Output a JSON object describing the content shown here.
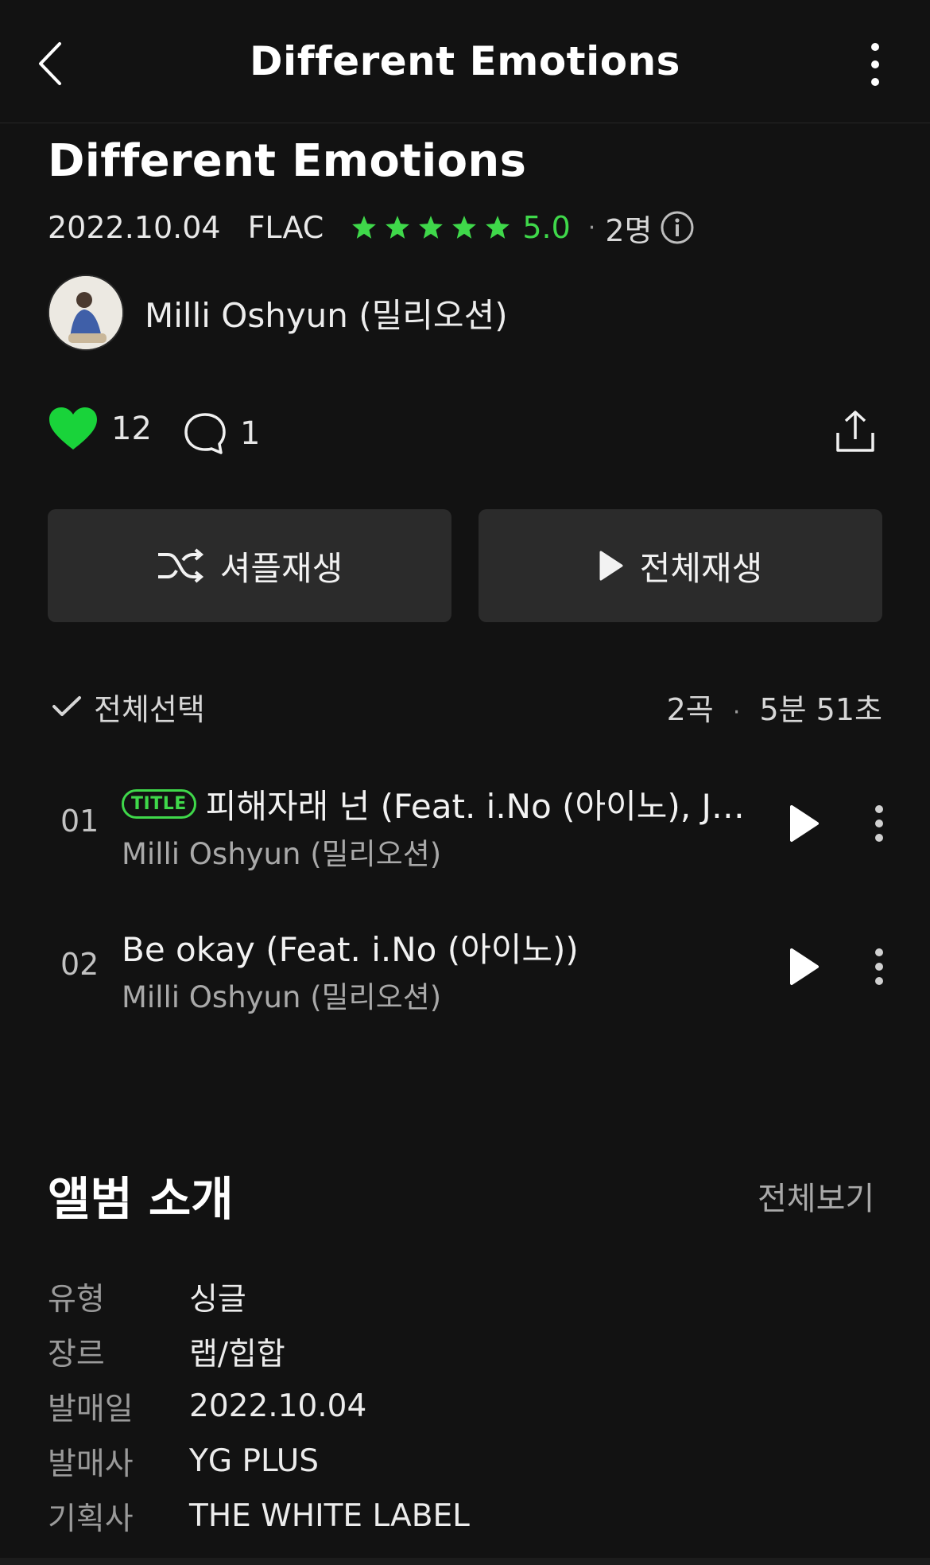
{
  "header": {
    "title": "Different Emotions"
  },
  "album": {
    "title": "Different Emotions",
    "release_date": "2022.10.04",
    "format": "FLAC",
    "rating_stars": 5,
    "rating": "5.0",
    "rater_count": "2명",
    "artist": "Milli Oshyun (밀리오션)"
  },
  "actions": {
    "like_count": "12",
    "comment_count": "1"
  },
  "buttons": {
    "shuffle_label": "셔플재생",
    "play_all_label": "전체재생"
  },
  "tracklist": {
    "select_all_label": "전체선택",
    "count": "2곡",
    "duration": "5분 51초",
    "tracks": [
      {
        "number": "01",
        "badge": "TITLE",
        "title": "피해자래 넌 (Feat. i.No (아이노), Je...",
        "artist": "Milli Oshyun (밀리오션)"
      },
      {
        "number": "02",
        "title": "Be okay (Feat. i.No (아이노))",
        "artist": "Milli Oshyun (밀리오션)"
      }
    ]
  },
  "intro": {
    "title": "앨범 소개",
    "view_all": "전체보기",
    "rows": [
      {
        "key": "유형",
        "value": "싱글"
      },
      {
        "key": "장르",
        "value": "랩/힙합"
      },
      {
        "key": "발매일",
        "value": "2022.10.04"
      },
      {
        "key": "발매사",
        "value": "YG PLUS"
      },
      {
        "key": "기획사",
        "value": "THE WHITE LABEL"
      }
    ]
  },
  "colors": {
    "accent_green": "#3fd84a",
    "background": "#121212",
    "button_bg": "#2b2b2b"
  }
}
